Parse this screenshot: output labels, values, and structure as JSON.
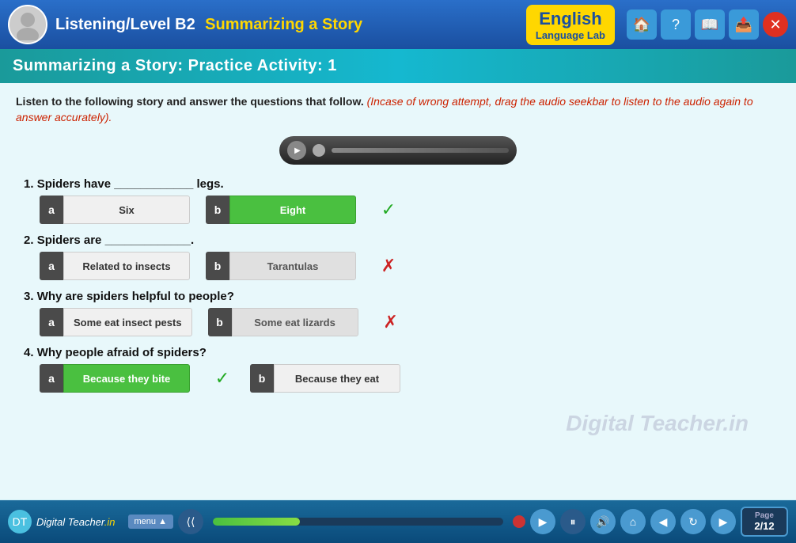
{
  "header": {
    "title": "Listening/Level B2",
    "subtitle": "Summarizing a Story",
    "app_name": "English",
    "app_subtitle": "Language Lab"
  },
  "subheader": {
    "title": "Summarizing a Story: Practice Activity: 1"
  },
  "instruction": {
    "main": "Listen to the following story and answer the questions that follow.",
    "italic": "(Incase of wrong attempt, drag the audio seekbar to listen to the audio again to answer accurately)."
  },
  "questions": [
    {
      "number": "1.",
      "text": "Spiders have ____________ legs.",
      "options": [
        {
          "letter": "a",
          "text": "Six",
          "style": "default",
          "result": ""
        },
        {
          "letter": "b",
          "text": "Eight",
          "style": "green",
          "result": "check"
        }
      ]
    },
    {
      "number": "2.",
      "text": "Spiders are _____________.",
      "options": [
        {
          "letter": "a",
          "text": "Related to insects",
          "style": "default",
          "result": ""
        },
        {
          "letter": "b",
          "text": "Tarantulas",
          "style": "gray",
          "result": "cross"
        }
      ]
    },
    {
      "number": "3.",
      "text": "Why are spiders helpful to people?",
      "options": [
        {
          "letter": "a",
          "text": "Some eat insect pests",
          "style": "default",
          "result": ""
        },
        {
          "letter": "b",
          "text": "Some eat lizards",
          "style": "gray",
          "result": "cross"
        }
      ]
    },
    {
      "number": "4.",
      "text": "Why people afraid of spiders?",
      "options": [
        {
          "letter": "a",
          "text": "Because they bite",
          "style": "green",
          "result": "check"
        },
        {
          "letter": "b",
          "text": "Because they eat",
          "style": "default",
          "result": ""
        }
      ]
    }
  ],
  "watermark": "Digital Teacher.in",
  "footer": {
    "logo_text": "Digital Teacher",
    "logo_suffix": ".in",
    "menu_label": "menu",
    "page": "2/12",
    "page_label": "Page"
  }
}
